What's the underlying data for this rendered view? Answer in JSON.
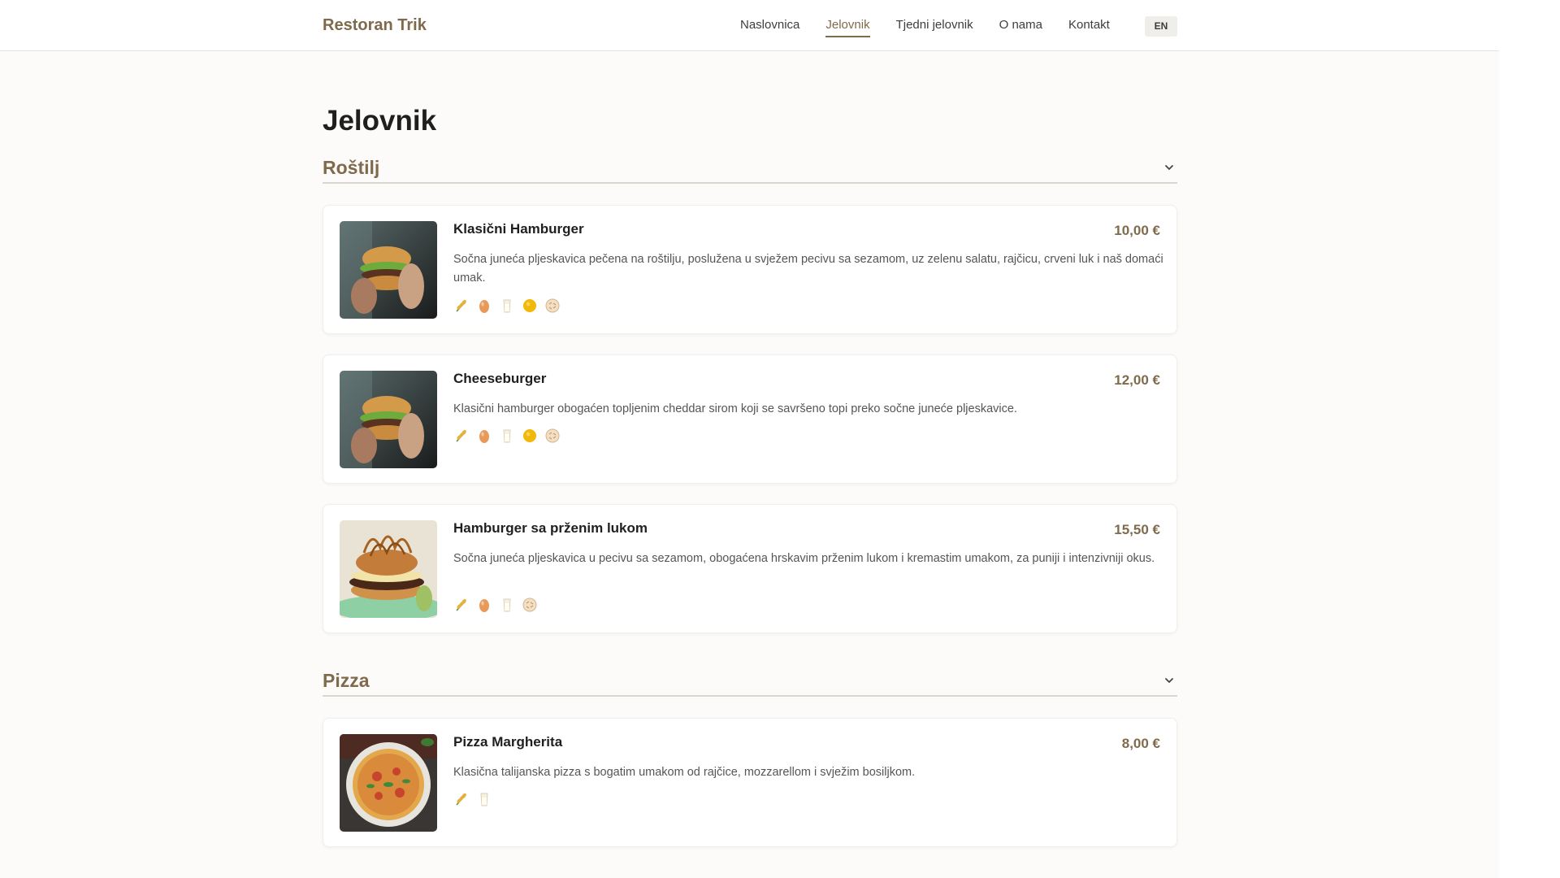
{
  "header": {
    "brand": "Restoran Trik",
    "nav": [
      {
        "label": "Naslovnica",
        "active": false
      },
      {
        "label": "Jelovnik",
        "active": true
      },
      {
        "label": "Tjedni jelovnik",
        "active": false
      },
      {
        "label": "O nama",
        "active": false
      },
      {
        "label": "Kontakt",
        "active": false
      }
    ],
    "lang": "EN"
  },
  "page": {
    "title": "Jelovnik"
  },
  "sections": [
    {
      "title": "Roštilj",
      "items": [
        {
          "name": "Klasični Hamburger",
          "price": "10,00 €",
          "description": "Sočna juneća pljeskavica pečena na roštilju, poslužena u svježem pecivu sa sezamom, uz zelenu salatu, rajčicu, crveni luk i naš domaći umak.",
          "image": "burger-held-photo",
          "allergens": [
            "gluten-icon",
            "egg-icon",
            "milk-icon",
            "mustard-icon",
            "sesame-icon"
          ]
        },
        {
          "name": "Cheeseburger",
          "price": "12,00 €",
          "description": "Klasični hamburger obogaćen topljenim cheddar sirom koji se savršeno topi preko sočne juneće pljeskavice.",
          "image": "burger-held-photo",
          "allergens": [
            "gluten-icon",
            "egg-icon",
            "milk-icon",
            "mustard-icon",
            "sesame-icon"
          ]
        },
        {
          "name": "Hamburger sa prženim lukom",
          "price": "15,50 €",
          "description": "Sočna juneća pljeskavica u pecivu sa sezamom, obogaćena hrskavim prženim lukom i kremastim umakom, za puniji i intenzivniji okus.",
          "image": "burger-onion-photo",
          "allergens": [
            "gluten-icon",
            "egg-icon",
            "milk-icon",
            "sesame-icon"
          ]
        }
      ]
    },
    {
      "title": "Pizza",
      "items": [
        {
          "name": "Pizza Margherita",
          "price": "8,00 €",
          "description": "Klasična talijanska pizza s bogatim umakom od rajčice, mozzarellom i svježim bosiljkom.",
          "image": "pizza-photo",
          "allergens": [
            "gluten-icon",
            "milk-icon"
          ]
        }
      ]
    }
  ],
  "colors": {
    "accent": "#806a4c",
    "background": "#fcfbf9",
    "card": "#ffffff",
    "text": "#1f1f1f"
  }
}
